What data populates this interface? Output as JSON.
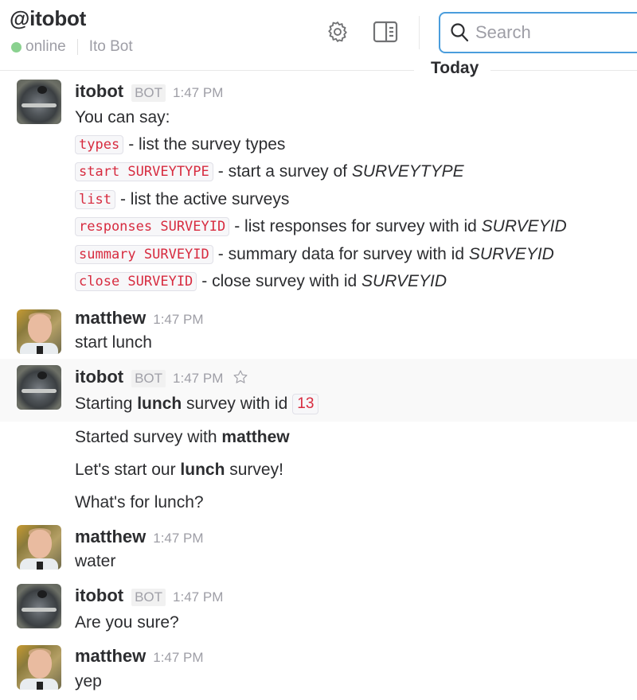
{
  "header": {
    "channel_name": "@itobot",
    "presence": "online",
    "full_name": "Ito Bot",
    "presence_color": "#8ad18f",
    "search_placeholder": "Search",
    "icons": [
      "gear-icon",
      "panel-toggle-icon",
      "search-icon"
    ]
  },
  "day_divider": "Today",
  "colors": {
    "accent": "#4a9ddc",
    "code_text": "#d72b3f",
    "highlight_row": "#f9f9f9"
  },
  "messages": [
    {
      "author": "itobot",
      "badge": "BOT",
      "time": "1:47 PM",
      "lines": {
        "intro": "You can say:",
        "commands": [
          {
            "code": "types",
            "desc": "- list the survey types",
            "em": ""
          },
          {
            "code": "start SURVEYTYPE",
            "desc": "- start a survey of ",
            "em": "SURVEYTYPE"
          },
          {
            "code": "list",
            "desc": "- list the active surveys",
            "em": ""
          },
          {
            "code": "responses SURVEYID",
            "desc": "- list responses for survey with id ",
            "em": "SURVEYID"
          },
          {
            "code": "summary SURVEYID",
            "desc": "- summary data for survey with id ",
            "em": "SURVEYID"
          },
          {
            "code": "close SURVEYID",
            "desc": "- close survey with id ",
            "em": "SURVEYID"
          }
        ]
      }
    },
    {
      "author": "matthew",
      "time": "1:47 PM",
      "text": "start lunch"
    },
    {
      "author": "itobot",
      "badge": "BOT",
      "time": "1:47 PM",
      "starting": {
        "pre": "Starting ",
        "bold": "lunch",
        "post": " survey with id",
        "id": "13"
      },
      "started": {
        "pre": "Started survey with ",
        "bold": "matthew"
      },
      "lets": {
        "pre": "Let's start our ",
        "bold": "lunch",
        "post": " survey!"
      },
      "question": "What's for lunch?"
    },
    {
      "author": "matthew",
      "time": "1:47 PM",
      "text": "water"
    },
    {
      "author": "itobot",
      "badge": "BOT",
      "time": "1:47 PM",
      "text": "Are you sure?"
    },
    {
      "author": "matthew",
      "time": "1:47 PM",
      "text": "yep"
    }
  ]
}
